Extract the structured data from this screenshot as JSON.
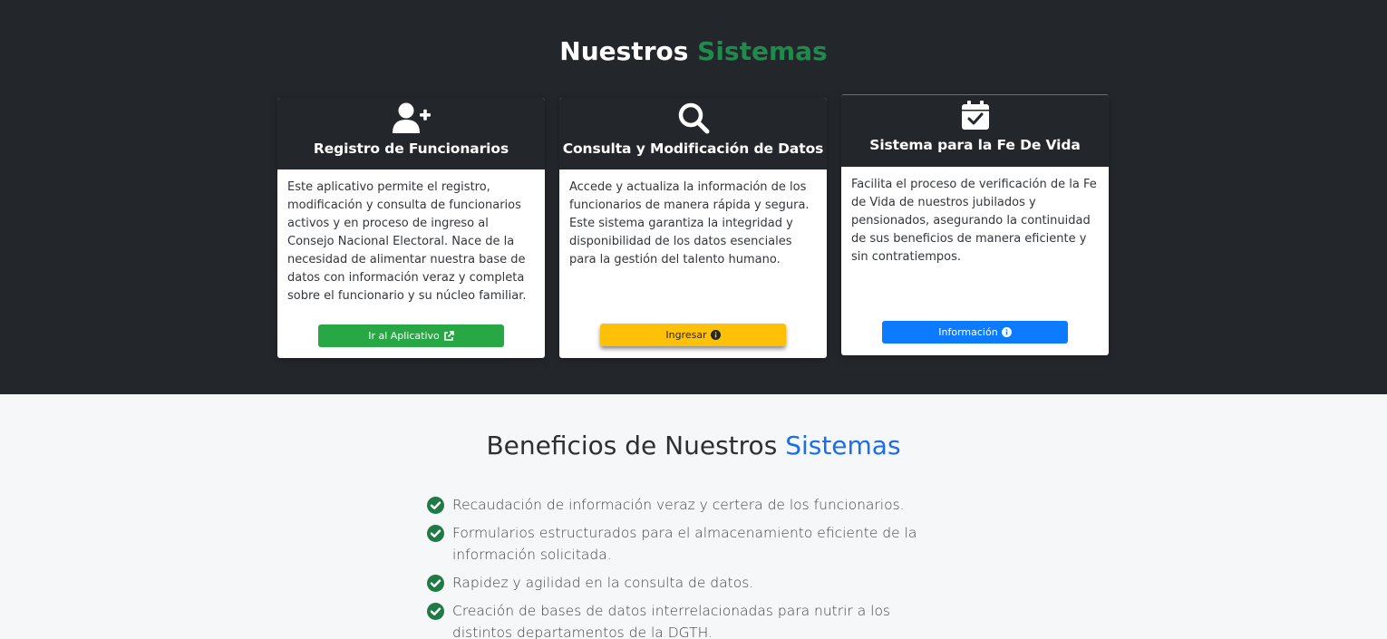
{
  "systems": {
    "title_main": "Nuestros",
    "title_accent": "Sistemas",
    "cards": [
      {
        "icon": "user-plus-icon",
        "title": "Registro de Funcionarios",
        "description": "Este aplicativo permite el registro, modificación y consulta de funcionarios activos y en proceso de ingreso al Consejo Nacional Electoral. Nace de la necesidad de alimentar nuestra base de datos con información veraz y completa sobre el funcionario y su núcleo familiar.",
        "button_label": "Ir al Aplicativo",
        "button_icon": "external-link-icon"
      },
      {
        "icon": "search-icon",
        "title": "Consulta y Modificación de Datos",
        "description": "Accede y actualiza la información de los funcionarios de manera rápida y segura. Este sistema garantiza la integridad y disponibilidad de los datos esenciales para la gestión del talento humano.",
        "button_label": "Ingresar",
        "button_icon": "info-circle-icon"
      },
      {
        "icon": "calendar-check-icon",
        "title": "Sistema para la Fe De Vida",
        "description": "Facilita el proceso de verificación de la Fe de Vida de nuestros jubilados y pensionados, asegurando la continuidad de sus beneficios de manera eficiente y sin contratiempos.",
        "button_label": "Información",
        "button_icon": "info-circle-icon"
      }
    ]
  },
  "benefits": {
    "title_main": "Beneficios de Nuestros",
    "title_accent": "Sistemas",
    "items": [
      "Recaudación de información veraz y certera de los funcionarios.",
      "Formularios estructurados para el almacenamiento eficiente de la información solicitada.",
      "Rapidez y agilidad en la consulta de datos.",
      "Creación de bases de datos interrelacionadas para nutrir a los distintos departamentos de la DGTH."
    ]
  },
  "colors": {
    "dark_bg": "#23262b",
    "green_accent": "#1f8a4c",
    "blue_accent": "#1a6ee8",
    "btn_green": "#28a745",
    "btn_yellow": "#ffc107",
    "btn_blue": "#0d7bff"
  }
}
